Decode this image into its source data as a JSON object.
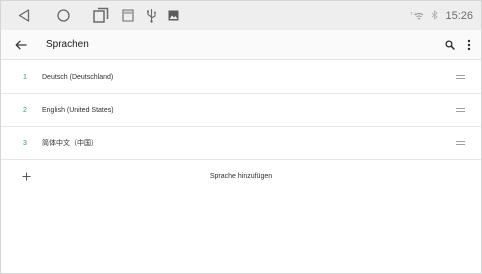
{
  "statusbar": {
    "nav_icons": [
      "back-triangle-icon",
      "home-circle-icon",
      "recents-square-icon",
      "sd-card-icon",
      "usb-icon",
      "image-icon"
    ],
    "wifi_icon": "wifi-icon",
    "bluetooth_icon": "bluetooth-icon",
    "time": "15:26"
  },
  "appbar": {
    "back_icon": "arrow-back-icon",
    "title": "Sprachen",
    "search_icon": "search-icon",
    "more_icon": "more-vert-icon"
  },
  "languages": [
    {
      "number": "1",
      "label": "Deutsch (Deutschland)"
    },
    {
      "number": "2",
      "label": "English (United States)"
    },
    {
      "number": "3",
      "label": "简体中文（中国）"
    }
  ],
  "add_language": {
    "icon": "plus-icon",
    "label": "Sprache hinzufügen"
  },
  "colors": {
    "accent": "#1a9e8f",
    "statusbar_bg": "#eeeeee",
    "appbar_bg": "#fafafa",
    "divider": "#e6e6e6"
  }
}
